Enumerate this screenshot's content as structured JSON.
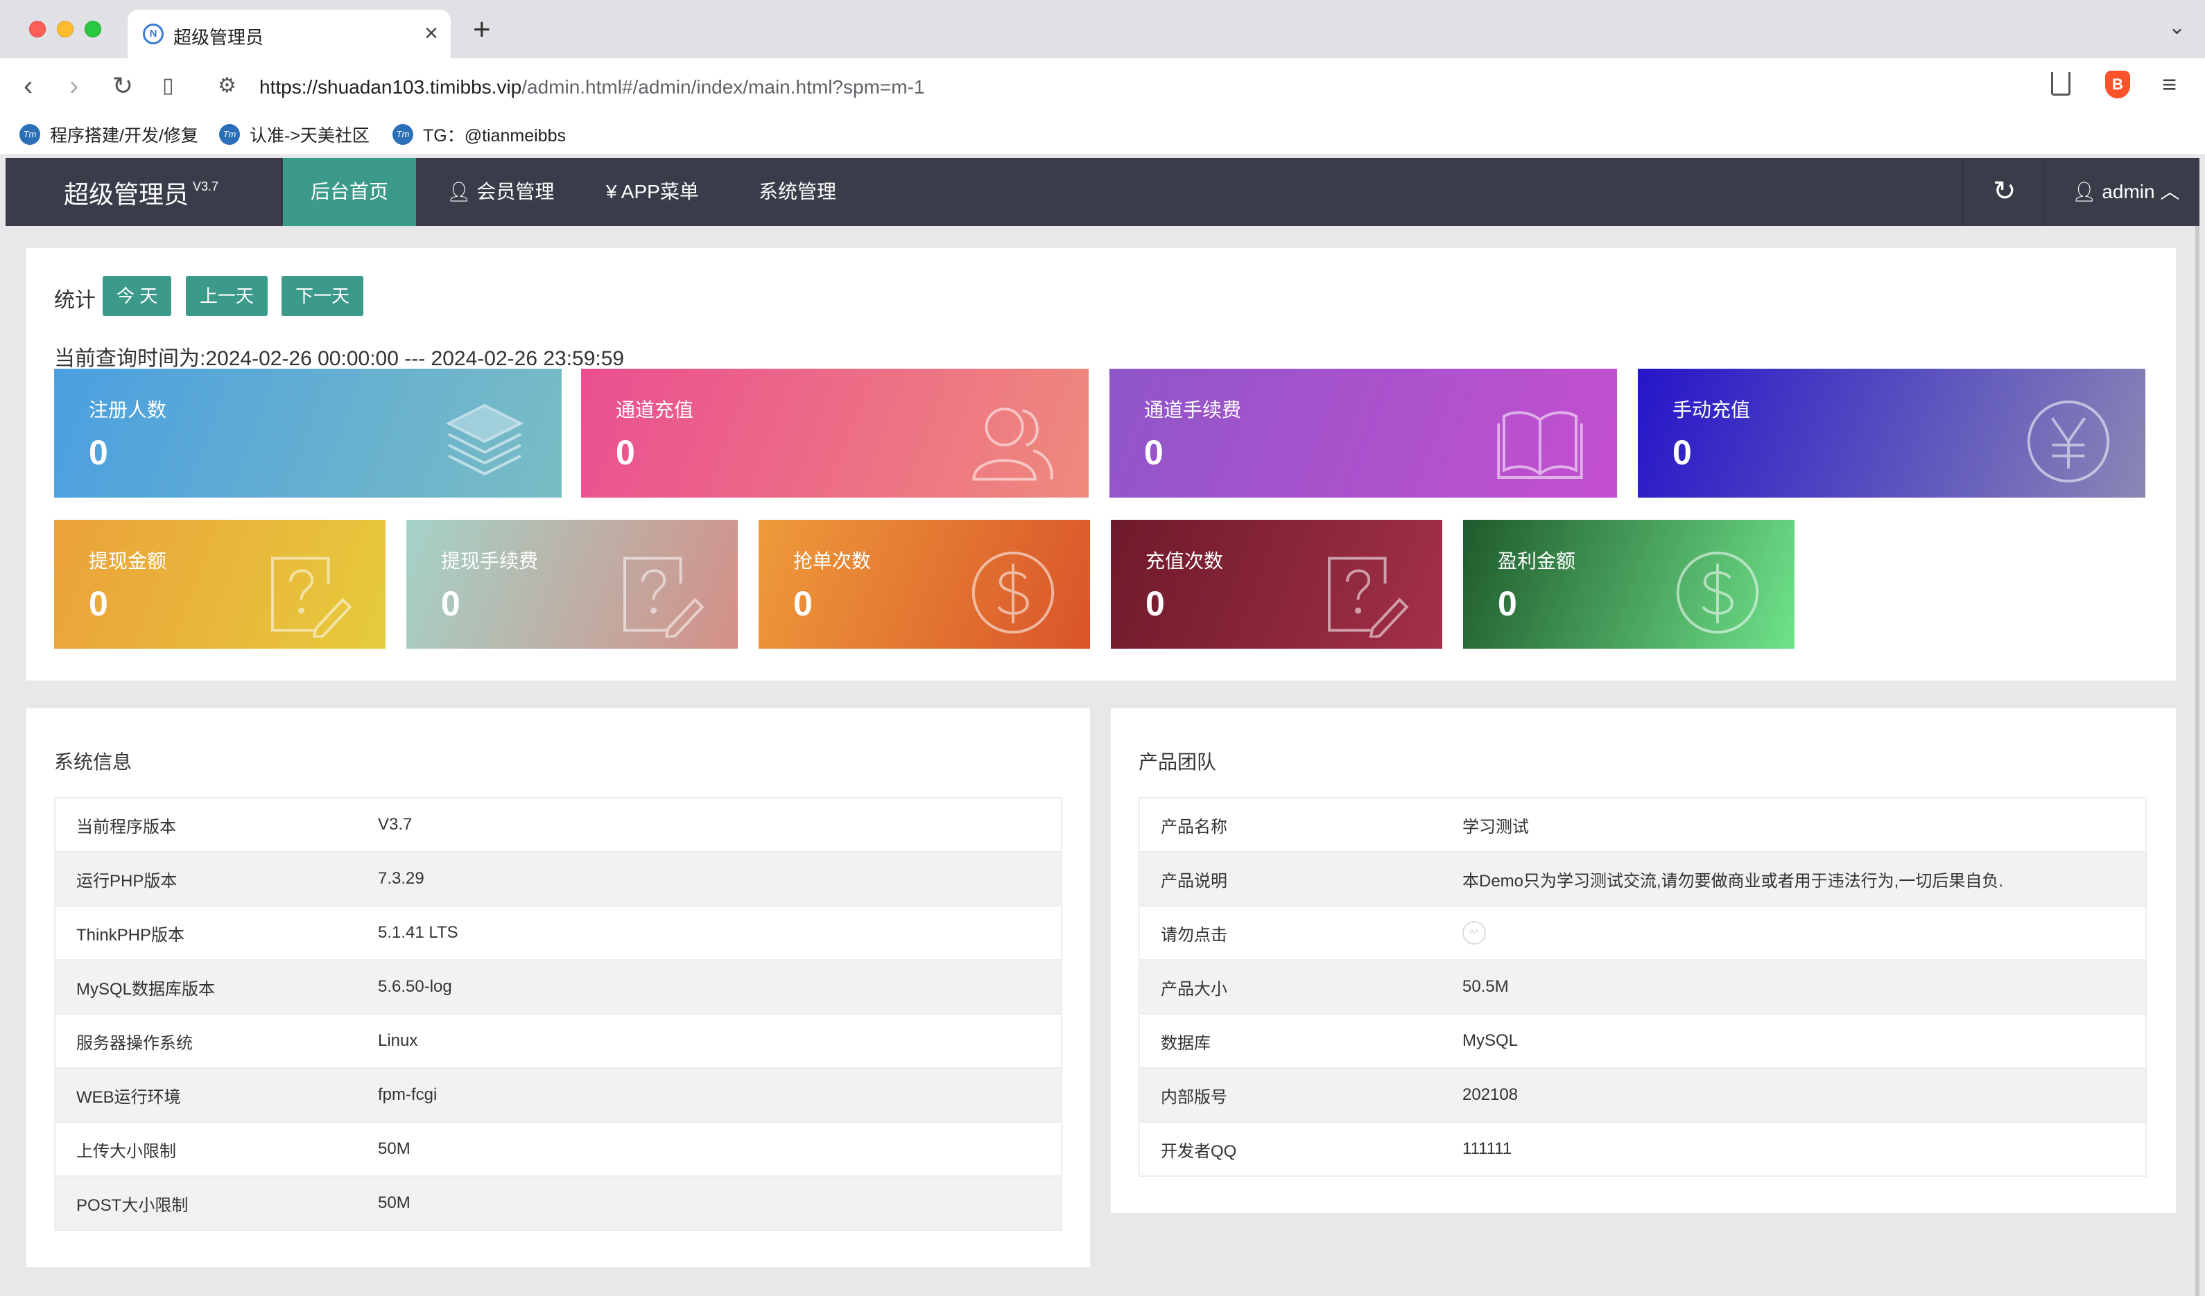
{
  "browser": {
    "tab_title": "超级管理员",
    "tab_favicon": "N",
    "url_host": "https://shuadan103.timibbs.vip",
    "url_path": "/admin.html#/admin/index/main.html?spm=m-1",
    "bookmarks": [
      {
        "label": "程序搭建/开发/修复"
      },
      {
        "label": "认准->天美社区"
      },
      {
        "label": "TG：@tianmeibbs"
      }
    ],
    "bookmark_icon_text": "Tm",
    "brave_icon_text": "B"
  },
  "header": {
    "brand": "超级管理员",
    "version": "V3.7",
    "nav": [
      {
        "label": "后台首页"
      },
      {
        "label": "会员管理"
      },
      {
        "label": "¥ APP菜单"
      },
      {
        "label": "系统管理"
      }
    ],
    "user": "admin"
  },
  "stats": {
    "label": "统计",
    "buttons": [
      "今 天",
      "上一天",
      "下一天"
    ],
    "query_range": "当前查询时间为:2024-02-26 00:00:00 --- 2024-02-26 23:59:59",
    "cards": [
      {
        "title": "注册人数",
        "value": "0",
        "icon": "layers-icon",
        "gradient": [
          "#4a9fe0",
          "#7bbdc4"
        ]
      },
      {
        "title": "通道充值",
        "value": "0",
        "icon": "users-icon",
        "gradient": [
          "#ea4f91",
          "#ef8a7c"
        ]
      },
      {
        "title": "通道手续费",
        "value": "0",
        "icon": "book-icon",
        "gradient": [
          "#8f56c9",
          "#c44fd0"
        ]
      },
      {
        "title": "手动充值",
        "value": "0",
        "icon": "yen-icon",
        "gradient": [
          "#2515c9",
          "#8a87b5"
        ]
      },
      {
        "title": "提现金额",
        "value": "0",
        "icon": "question-doc-icon",
        "gradient": [
          "#eba13a",
          "#e6cb3c"
        ]
      },
      {
        "title": "提现手续费",
        "value": "0",
        "icon": "question-doc-icon",
        "gradient": [
          "#a4d3c8",
          "#d48f87"
        ]
      },
      {
        "title": "抢单次数",
        "value": "0",
        "icon": "dollar-icon",
        "gradient": [
          "#ee9b3a",
          "#d9542a"
        ]
      },
      {
        "title": "充值次数",
        "value": "0",
        "icon": "question-doc-icon",
        "gradient": [
          "#6e1a2a",
          "#a33048"
        ]
      },
      {
        "title": "盈利金额",
        "value": "0",
        "icon": "dollar-icon",
        "gradient": [
          "#1f5a2c",
          "#6fe38a"
        ]
      }
    ]
  },
  "system_info": {
    "title": "系统信息",
    "rows": [
      [
        "当前程序版本",
        "V3.7"
      ],
      [
        "运行PHP版本",
        "7.3.29"
      ],
      [
        "ThinkPHP版本",
        "5.1.41 LTS"
      ],
      [
        "MySQL数据库版本",
        "5.6.50-log"
      ],
      [
        "服务器操作系统",
        "Linux"
      ],
      [
        "WEB运行环境",
        "fpm-fcgi"
      ],
      [
        "上传大小限制",
        "50M"
      ],
      [
        "POST大小限制",
        "50M"
      ]
    ]
  },
  "product_team": {
    "title": "产品团队",
    "rows": [
      [
        "产品名称",
        "学习测试"
      ],
      [
        "产品说明",
        "本Demo只为学习测试交流,请勿要做商业或者用于违法行为,一切后果自负."
      ],
      [
        "请勿点击",
        ""
      ],
      [
        "产品大小",
        "50.5M"
      ],
      [
        "数据库",
        "MySQL"
      ],
      [
        "内部版号",
        "202108"
      ],
      [
        "开发者QQ",
        "111111"
      ]
    ],
    "smiley_text": "^^"
  }
}
